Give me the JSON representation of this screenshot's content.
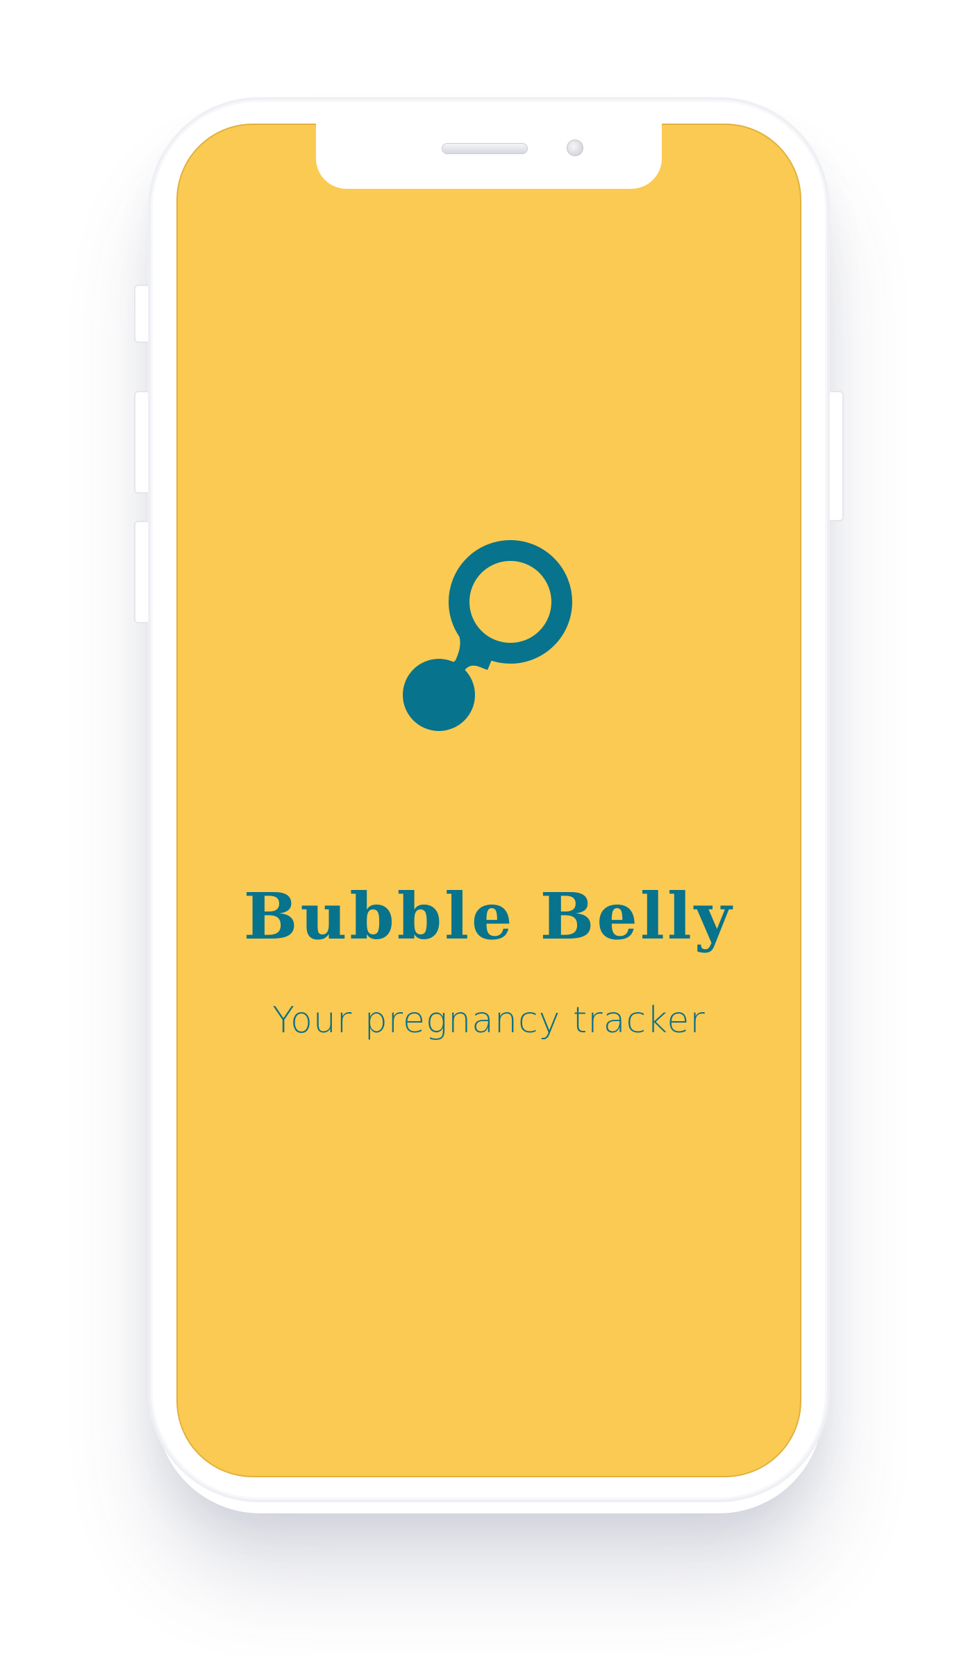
{
  "app": {
    "title": "Bubble Belly",
    "subtitle": "Your pregnancy tracker"
  },
  "icons": {
    "logo": "bubble-belly-logo-icon",
    "speaker": "speaker-grille",
    "camera": "front-camera"
  },
  "colors": {
    "screen_background": "#fbca52",
    "brand_teal": "#07738c",
    "device_frame": "#ffffff"
  }
}
